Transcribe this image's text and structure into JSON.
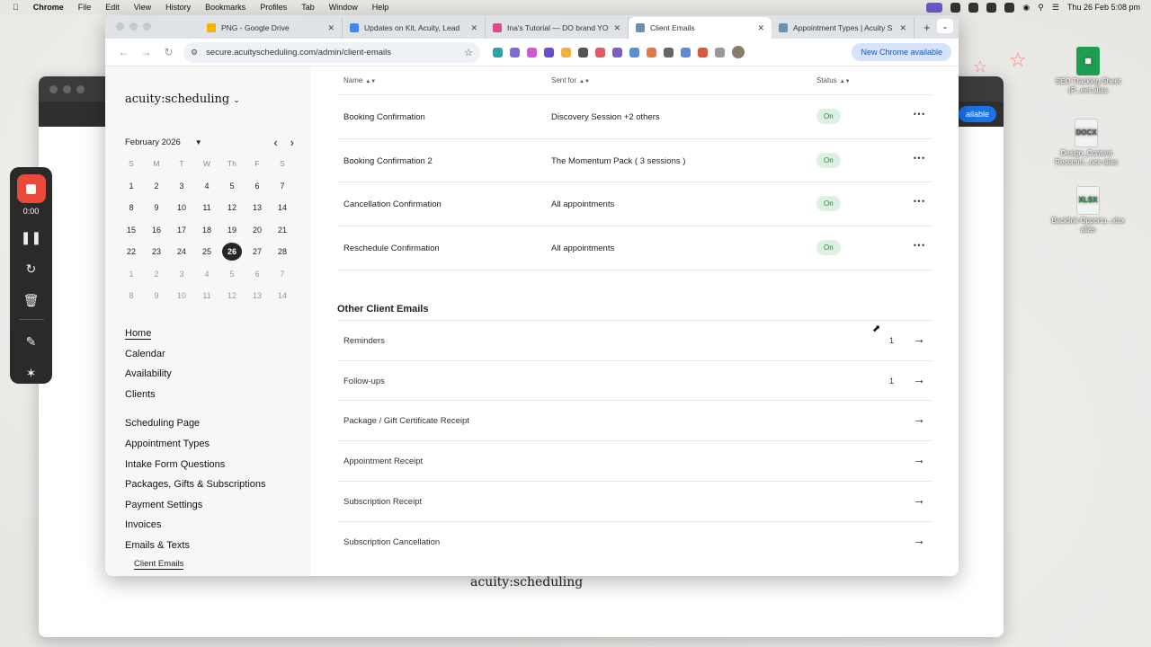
{
  "menubar": {
    "app": "Chrome",
    "items": [
      "File",
      "Edit",
      "View",
      "History",
      "Bookmarks",
      "Profiles",
      "Tab",
      "Window",
      "Help"
    ],
    "clock": "Thu 26 Feb  5:08 pm"
  },
  "recorder": {
    "time": "0:00"
  },
  "desktop_files": [
    {
      "name": "SEO Tracking Sheet (P...eet alias",
      "type": "sheet"
    },
    {
      "name": "Design_Content Recomm...ocx alias",
      "type": "DOCX"
    },
    {
      "name": "Backlink Opportu...xlsx alias",
      "type": "XLSX"
    }
  ],
  "background_window": {
    "pill": "ailable",
    "footer_logo": "acuity:scheduling"
  },
  "browser": {
    "tabs": [
      {
        "title": "PNG - Google Drive",
        "color": "#f4b400"
      },
      {
        "title": "Updates on Kit, Acuity, Lead",
        "color": "#4285f4"
      },
      {
        "title": "Ina's Tutorial — DO brand YO",
        "color": "#e04a8a"
      },
      {
        "title": "Client Emails",
        "color": "#6b8fb0",
        "active": true
      },
      {
        "title": "Appointment Types | Acuity S",
        "color": "#6b8fb0"
      }
    ],
    "url": "secure.acuityscheduling.com/admin/client-emails",
    "update_button": "New Chrome available"
  },
  "sidebar": {
    "logo": "acuity:scheduling",
    "calendar": {
      "month": "February 2026",
      "weekdays": [
        "S",
        "M",
        "T",
        "W",
        "Th",
        "F",
        "S"
      ],
      "weeks": [
        [
          "1",
          "2",
          "3",
          "4",
          "5",
          "6",
          "7"
        ],
        [
          "8",
          "9",
          "10",
          "11",
          "12",
          "13",
          "14"
        ],
        [
          "15",
          "16",
          "17",
          "18",
          "19",
          "20",
          "21"
        ],
        [
          "22",
          "23",
          "24",
          "25",
          "26",
          "27",
          "28"
        ],
        [
          "1",
          "2",
          "3",
          "4",
          "5",
          "6",
          "7"
        ],
        [
          "8",
          "9",
          "10",
          "11",
          "12",
          "13",
          "14"
        ]
      ],
      "today": "26"
    },
    "nav_group1": [
      "Home",
      "Calendar",
      "Availability",
      "Clients"
    ],
    "nav_group2": [
      "Scheduling Page",
      "Appointment Types",
      "Intake Form Questions",
      "Packages, Gifts & Subscriptions",
      "Payment Settings",
      "Invoices",
      "Emails & Texts"
    ],
    "sub_item": "Client Emails"
  },
  "main": {
    "columns": {
      "name": "Name",
      "sent_for": "Sent for",
      "status": "Status"
    },
    "rows": [
      {
        "name": "Booking Confirmation",
        "sent_for": "Discovery Session +2 others",
        "status": "On"
      },
      {
        "name": "Booking Confirmation 2",
        "sent_for": "The Momentum Pack ( 3 sessions )",
        "status": "On"
      },
      {
        "name": "Cancellation Confirmation",
        "sent_for": "All appointments",
        "status": "On"
      },
      {
        "name": "Reschedule Confirmation",
        "sent_for": "All appointments",
        "status": "On"
      }
    ],
    "other_title": "Other Client Emails",
    "other": [
      {
        "name": "Reminders",
        "count": "1"
      },
      {
        "name": "Follow-ups",
        "count": "1"
      },
      {
        "name": "Package / Gift Certificate Receipt",
        "count": ""
      },
      {
        "name": "Appointment Receipt",
        "count": ""
      },
      {
        "name": "Subscription Receipt",
        "count": ""
      },
      {
        "name": "Subscription Cancellation",
        "count": ""
      }
    ]
  }
}
